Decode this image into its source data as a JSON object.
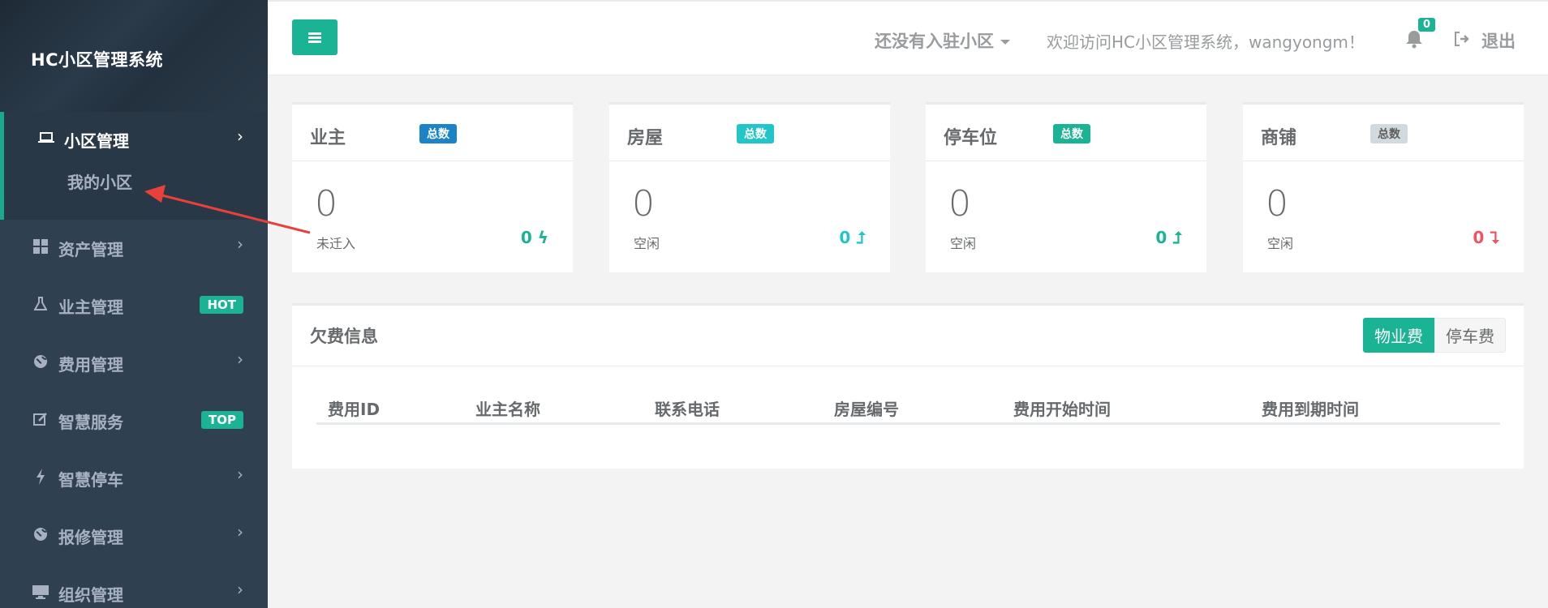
{
  "sidebar": {
    "brand": "HC小区管理系统",
    "items": [
      {
        "label": "小区管理",
        "icon": "laptop-icon",
        "glyph": "💻"
      },
      {
        "label": "资产管理",
        "icon": "grid-icon",
        "glyph": "▦"
      },
      {
        "label": "业主管理",
        "icon": "flask-icon",
        "glyph": "⚗",
        "badge": "HOT"
      },
      {
        "label": "费用管理",
        "icon": "globe-icon",
        "glyph": "●"
      },
      {
        "label": "智慧服务",
        "icon": "edit-icon",
        "glyph": "✎",
        "badge": "TOP"
      },
      {
        "label": "智慧停车",
        "icon": "bolt-icon",
        "glyph": "ϟ"
      },
      {
        "label": "报修管理",
        "icon": "globe-icon",
        "glyph": "●"
      },
      {
        "label": "组织管理",
        "icon": "desktop-icon",
        "glyph": "▭"
      }
    ],
    "sub_item": "我的小区",
    "chevron": "›"
  },
  "topbar": {
    "community": "还没有入驻小区",
    "welcome": "欢迎访问HC小区管理系统，wangyongm！",
    "notify_count": "0",
    "logout": "退出"
  },
  "cards": [
    {
      "title": "业主",
      "tag": "总数",
      "tag_color": "#1c84c6",
      "count": "0",
      "sub": "未迁入",
      "stat": "0 ϟ",
      "stat_color": "#1ab394"
    },
    {
      "title": "房屋",
      "tag": "总数",
      "tag_color": "#23c6c8",
      "count": "0",
      "sub": "空闲",
      "stat": "0 ⮥",
      "stat_color": "#23c6c8"
    },
    {
      "title": "停车位",
      "tag": "总数",
      "tag_color": "#1ab394",
      "count": "0",
      "sub": "空闲",
      "stat": "0 ⮥",
      "stat_color": "#1ab394"
    },
    {
      "title": "商铺",
      "tag": "总数",
      "tag_color": "#d1dade",
      "count": "0",
      "sub": "空闲",
      "stat": "0 ⮧",
      "stat_color": "#ed5565"
    }
  ],
  "arrears": {
    "title": "欠费信息",
    "tabs": [
      "物业费",
      "停车费"
    ],
    "columns": [
      "费用ID",
      "业主名称",
      "联系电话",
      "房屋编号",
      "费用开始时间",
      "费用到期时间"
    ]
  }
}
